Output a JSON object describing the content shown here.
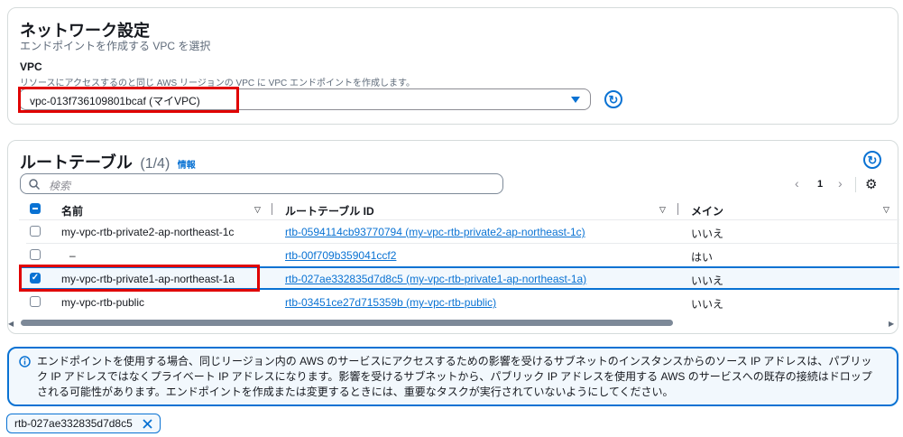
{
  "network": {
    "title": "ネットワーク設定",
    "subtitle": "エンドポイントを作成する VPC を選択",
    "vpc_label": "VPC",
    "vpc_description": "リソースにアクセスするのと同じ AWS リージョンの VPC に VPC エンドポイントを作成します。",
    "vpc_selected": "vpc-013f736109801bcaf (マイVPC)"
  },
  "route_tables": {
    "title": "ルートテーブル",
    "count": "(1/4)",
    "info_link": "情報",
    "search_placeholder": "検索",
    "page_number": "1",
    "columns": [
      "名前",
      "ルートテーブル ID",
      "メイン"
    ],
    "rows": [
      {
        "name": "my-vpc-rtb-private2-ap-northeast-1c",
        "id": "rtb-0594114cb93770794 (my-vpc-rtb-private2-ap-northeast-1c)",
        "main": "いいえ",
        "selected": false
      },
      {
        "name": "–",
        "id": "rtb-00f709b359041ccf2",
        "main": "はい",
        "selected": false
      },
      {
        "name": "my-vpc-rtb-private1-ap-northeast-1a",
        "id": "rtb-027ae332835d7d8c5 (my-vpc-rtb-private1-ap-northeast-1a)",
        "main": "いいえ",
        "selected": true
      },
      {
        "name": "my-vpc-rtb-public",
        "id": "rtb-03451ce27d715359b (my-vpc-rtb-public)",
        "main": "いいえ",
        "selected": false
      }
    ]
  },
  "alert": {
    "text": "エンドポイントを使用する場合、同じリージョン内の AWS のサービスにアクセスするための影響を受けるサブネットのインスタンスからのソース IP アドレスは、パブリック IP アドレスではなくプライベート IP アドレスになります。影響を受けるサブネットから、パブリック IP アドレスを使用する AWS のサービスへの既存の接続はドロップされる可能性があります。エンドポイントを作成または変更するときには、重要なタスクが実行されていないようにしてください。"
  },
  "selected_token": "rtb-027ae332835d7d8c5",
  "icons": {
    "refresh": "refresh-icon",
    "dropdown": "caret-down-icon",
    "search": "search-icon",
    "settings": "gear-icon",
    "info": "info-icon",
    "remove": "close-icon"
  },
  "colors": {
    "accent": "#0972d3",
    "highlight": "#e00000",
    "selected_row_bg": "#f2f8fd"
  }
}
